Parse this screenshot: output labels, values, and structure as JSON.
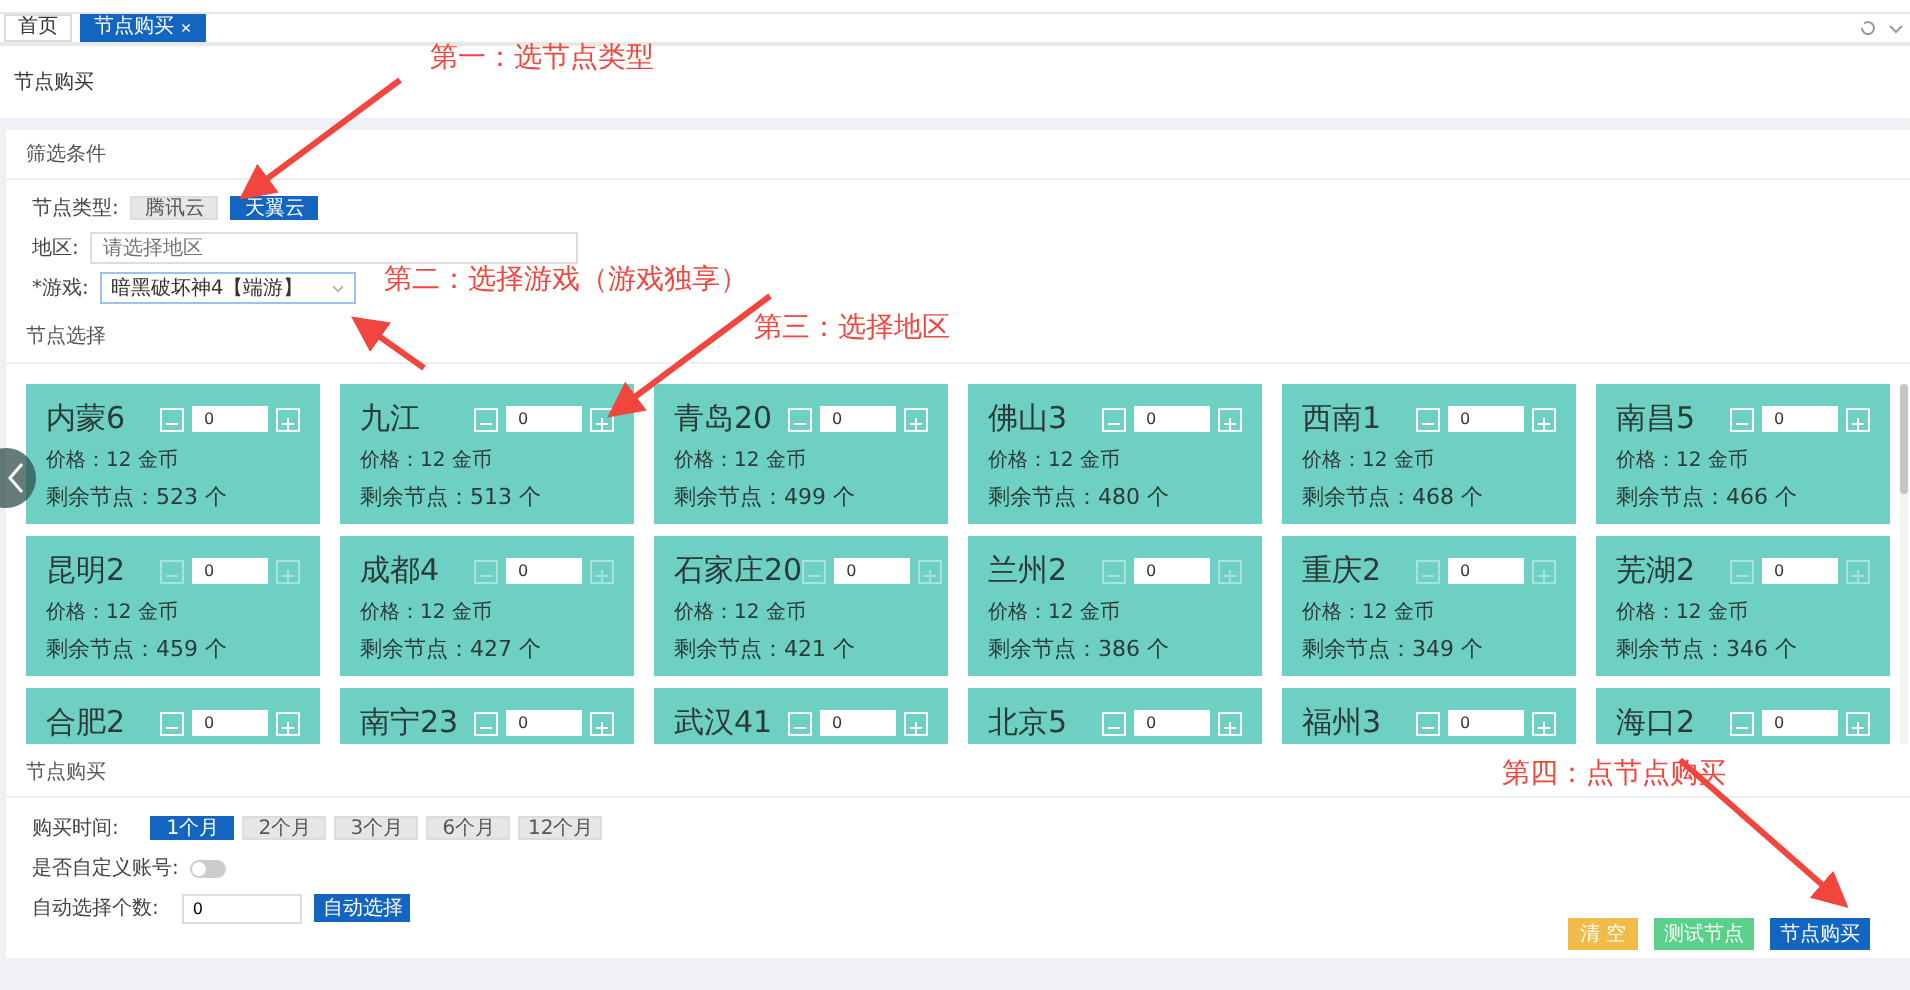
{
  "tabs": [
    {
      "label": "首页",
      "selected": false,
      "closable": false
    },
    {
      "label": "节点购买",
      "selected": true,
      "closable": true
    }
  ],
  "page_title": "节点购买",
  "filter": {
    "title": "筛选条件",
    "node_type": {
      "label": "节点类型:",
      "options": [
        {
          "label": "腾讯云",
          "selected": false
        },
        {
          "label": "天翼云",
          "selected": true
        }
      ]
    },
    "region": {
      "label": "地区:",
      "placeholder": "请选择地区"
    },
    "game": {
      "label": "*游戏:",
      "value": "暗黑破坏神4【端游】"
    }
  },
  "node_select": {
    "title": "节点选择",
    "nodes": [
      {
        "name": "内蒙6",
        "price": "价格：12 金币",
        "remaining": "剩余节点：523 个",
        "quantity": "0",
        "disabled": false
      },
      {
        "name": "九江",
        "price": "价格：12 金币",
        "remaining": "剩余节点：513 个",
        "quantity": "0",
        "disabled": false
      },
      {
        "name": "青岛20",
        "price": "价格：12 金币",
        "remaining": "剩余节点：499 个",
        "quantity": "0",
        "disabled": false
      },
      {
        "name": "佛山3",
        "price": "价格：12 金币",
        "remaining": "剩余节点：480 个",
        "quantity": "0",
        "disabled": false
      },
      {
        "name": "西南1",
        "price": "价格：12 金币",
        "remaining": "剩余节点：468 个",
        "quantity": "0",
        "disabled": false
      },
      {
        "name": "南昌5",
        "price": "价格：12 金币",
        "remaining": "剩余节点：466 个",
        "quantity": "0",
        "disabled": false
      },
      {
        "name": "昆明2",
        "price": "价格：12 金币",
        "remaining": "剩余节点：459 个",
        "quantity": "0",
        "disabled": true
      },
      {
        "name": "成都4",
        "price": "价格：12 金币",
        "remaining": "剩余节点：427 个",
        "quantity": "0",
        "disabled": true
      },
      {
        "name": "石家庄20",
        "price": "价格：12 金币",
        "remaining": "剩余节点：421 个",
        "quantity": "0",
        "disabled": true
      },
      {
        "name": "兰州2",
        "price": "价格：12 金币",
        "remaining": "剩余节点：386 个",
        "quantity": "0",
        "disabled": true
      },
      {
        "name": "重庆2",
        "price": "价格：12 金币",
        "remaining": "剩余节点：349 个",
        "quantity": "0",
        "disabled": true
      },
      {
        "name": "芜湖2",
        "price": "价格：12 金币",
        "remaining": "剩余节点：346 个",
        "quantity": "0",
        "disabled": true
      },
      {
        "name": "合肥2",
        "quantity": "0",
        "disabled": false
      },
      {
        "name": "南宁23",
        "quantity": "0",
        "disabled": false
      },
      {
        "name": "武汉41",
        "quantity": "0",
        "disabled": false
      },
      {
        "name": "北京5",
        "quantity": "0",
        "disabled": false
      },
      {
        "name": "福州3",
        "quantity": "0",
        "disabled": false
      },
      {
        "name": "海口2",
        "quantity": "0",
        "disabled": false
      }
    ]
  },
  "purchase": {
    "title": "节点购买",
    "duration": {
      "label": "购买时间:",
      "options": [
        {
          "label": "1个月",
          "selected": true
        },
        {
          "label": "2个月",
          "selected": false
        },
        {
          "label": "3个月",
          "selected": false
        },
        {
          "label": "6个月",
          "selected": false
        },
        {
          "label": "12个月",
          "selected": false
        }
      ]
    },
    "custom_account": {
      "label": "是否自定义账号:",
      "on": false
    },
    "auto_select": {
      "label": "自动选择个数:",
      "value": "0",
      "button": "自动选择"
    }
  },
  "actions": [
    {
      "label": "清 空",
      "kind": "warning"
    },
    {
      "label": "测试节点",
      "kind": "success"
    },
    {
      "label": "节点购买",
      "kind": "primary"
    }
  ],
  "annotations": [
    "第一：选节点类型",
    "第二：选择游戏（游戏独享）",
    "第三：选择地区",
    "第四：点节点购买"
  ]
}
